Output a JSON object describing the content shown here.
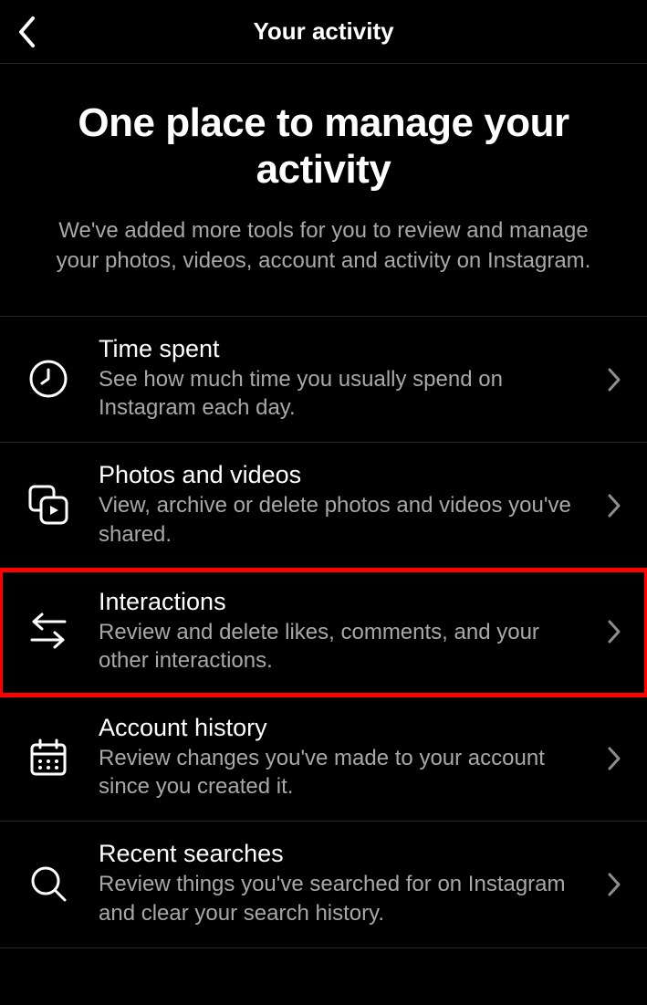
{
  "header": {
    "title": "Your activity"
  },
  "intro": {
    "heading": "One place to manage your activity",
    "sub": "We've added more tools for you to review and manage your photos, videos, account and activity on Instagram."
  },
  "rows": {
    "timeSpent": {
      "title": "Time spent",
      "desc": "See how much time you usually spend on Instagram each day."
    },
    "photosVideos": {
      "title": "Photos and videos",
      "desc": "View, archive or delete photos and videos you've shared."
    },
    "interactions": {
      "title": "Interactions",
      "desc": "Review and delete likes, comments, and your other interactions."
    },
    "accountHistory": {
      "title": "Account history",
      "desc": "Review changes you've made to your account since you created it."
    },
    "recentSearches": {
      "title": "Recent searches",
      "desc": "Review things you've searched for on Instagram and clear your search history."
    }
  }
}
